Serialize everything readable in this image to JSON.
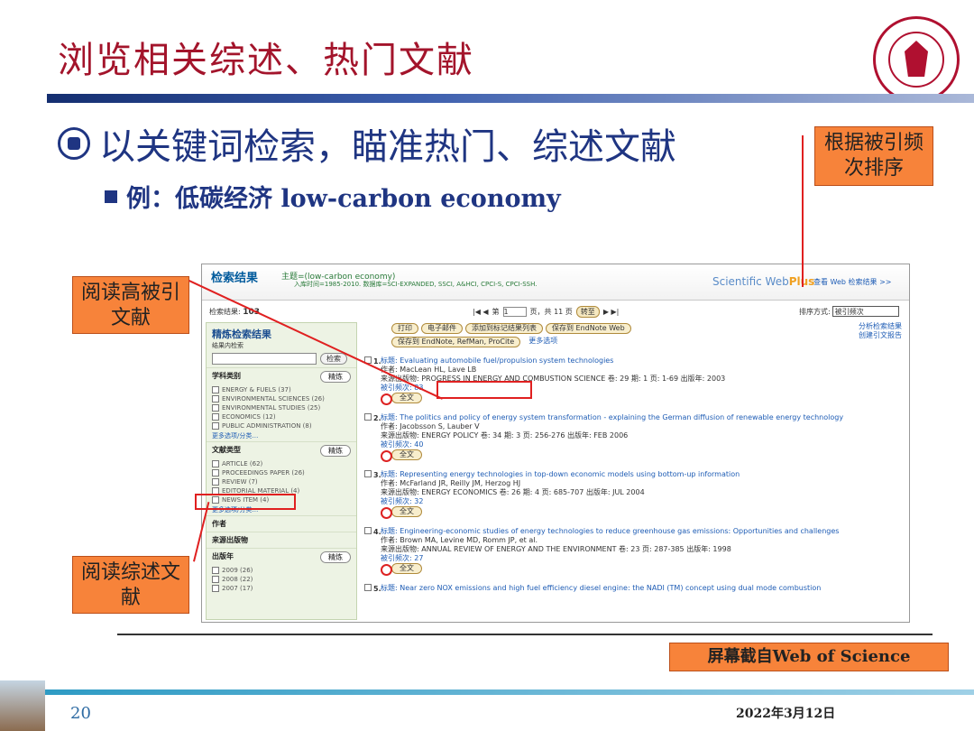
{
  "slide": {
    "title": "浏览相关综述、热门文献",
    "heading": "以关键词检索，瞄准热门、综述文献",
    "subheading": "例：低碳经济 low-carbon economy",
    "page_number": "20",
    "date": "2022年3月12日"
  },
  "callouts": {
    "sort_by_citations": "根据被引频次排序",
    "read_highly_cited": "阅读高被引文献",
    "read_reviews": "阅读综述文献",
    "source": "屏幕截自Web of Science"
  },
  "logo": {
    "ring_text": "SHANGHAI JIAO TONG UNIVERSITY"
  },
  "wos": {
    "title": "检索结果",
    "query": "主题=(low-carbon economy)",
    "query_meta": "入库时间=1985-2010. 数据库=SCI-EXPANDED, SSCI, A&HCI, CPCI-S, CPCI-SSH.",
    "brand": "Scientific WebPlus",
    "brand_a": "Scientific Web",
    "brand_b": "Plus",
    "view_web": "查看 Web 检索结果 >>",
    "count_label": "检索结果:",
    "count": "103",
    "pager": {
      "first_prev": "|◀ ◀",
      "page_label": "第",
      "page_value": "1",
      "page_suffix": "页，共 11 页",
      "go": "转至",
      "next_last": "▶ ▶|"
    },
    "sort": {
      "label": "排序方式:",
      "value": "被引频次"
    },
    "tools": [
      "打印",
      "电子邮件",
      "添加到标记结果列表",
      "保存到 EndNote Web",
      "保存到 EndNote, RefMan, ProCite"
    ],
    "tools_more": "更多选项",
    "right_links": [
      "分析检索结果",
      "创建引文报告"
    ],
    "refine": {
      "title": "精炼检索结果",
      "within": "结果内检索",
      "search_btn": "检索",
      "refine_btn": "精炼",
      "sections": [
        {
          "name": "学科类别",
          "items": [
            "ENERGY & FUELS (37)",
            "ENVIRONMENTAL SCIENCES (26)",
            "ENVIRONMENTAL STUDIES (25)",
            "ECONOMICS (12)",
            "PUBLIC ADMINISTRATION (8)"
          ],
          "more": "更多选项/分类…"
        },
        {
          "name": "文献类型",
          "items": [
            "ARTICLE (62)",
            "PROCEEDINGS PAPER (26)",
            "REVIEW (7)",
            "EDITORIAL MATERIAL (4)",
            "NEWS ITEM (4)"
          ],
          "more": "更多选项/分类…"
        },
        {
          "name": "作者",
          "items": [],
          "more": ""
        },
        {
          "name": "来源出版物",
          "items": [],
          "more": ""
        },
        {
          "name": "出版年",
          "items": [
            "2009 (26)",
            "2008 (22)",
            "2007 (17)"
          ],
          "more": ""
        }
      ]
    },
    "records": [
      {
        "n": "1.",
        "title": "标题: Evaluating automobile fuel/propulsion system technologies",
        "authors": "作者: MacLean HL, Lave LB",
        "source": "来源出版物: PROGRESS IN ENERGY AND COMBUSTION SCIENCE  卷: 29  期: 1  页: 1-69  出版年: 2003",
        "cited": "被引频次: 83"
      },
      {
        "n": "2.",
        "title": "标题: The politics and policy of energy system transformation - explaining the German diffusion of renewable energy technology",
        "authors": "作者: Jacobsson S, Lauber V",
        "source": "来源出版物: ENERGY POLICY  卷: 34  期: 3  页: 256-276  出版年: FEB 2006",
        "cited": "被引频次: 40"
      },
      {
        "n": "3.",
        "title": "标题: Representing energy technologies in top-down economic models using bottom-up information",
        "authors": "作者: McFarland JR, Reilly JM, Herzog HJ",
        "source": "来源出版物: ENERGY ECONOMICS  卷: 26  期: 4  页: 685-707  出版年: JUL 2004",
        "cited": "被引频次: 32"
      },
      {
        "n": "4.",
        "title": "标题: Engineering-economic studies of energy technologies to reduce greenhouse gas emissions: Opportunities and challenges",
        "authors": "作者: Brown MA, Levine MD, Romm JP, et al.",
        "source": "来源出版物: ANNUAL REVIEW OF ENERGY AND THE ENVIRONMENT  卷: 23  页: 287-385  出版年: 1998",
        "cited": "被引频次: 27"
      },
      {
        "n": "5.",
        "title": "标题: Near zero NOX emissions and high fuel efficiency diesel engine: the NADI (TM) concept using dual mode combustion",
        "authors": "",
        "source": "",
        "cited": ""
      }
    ],
    "fulltext": "全文"
  }
}
